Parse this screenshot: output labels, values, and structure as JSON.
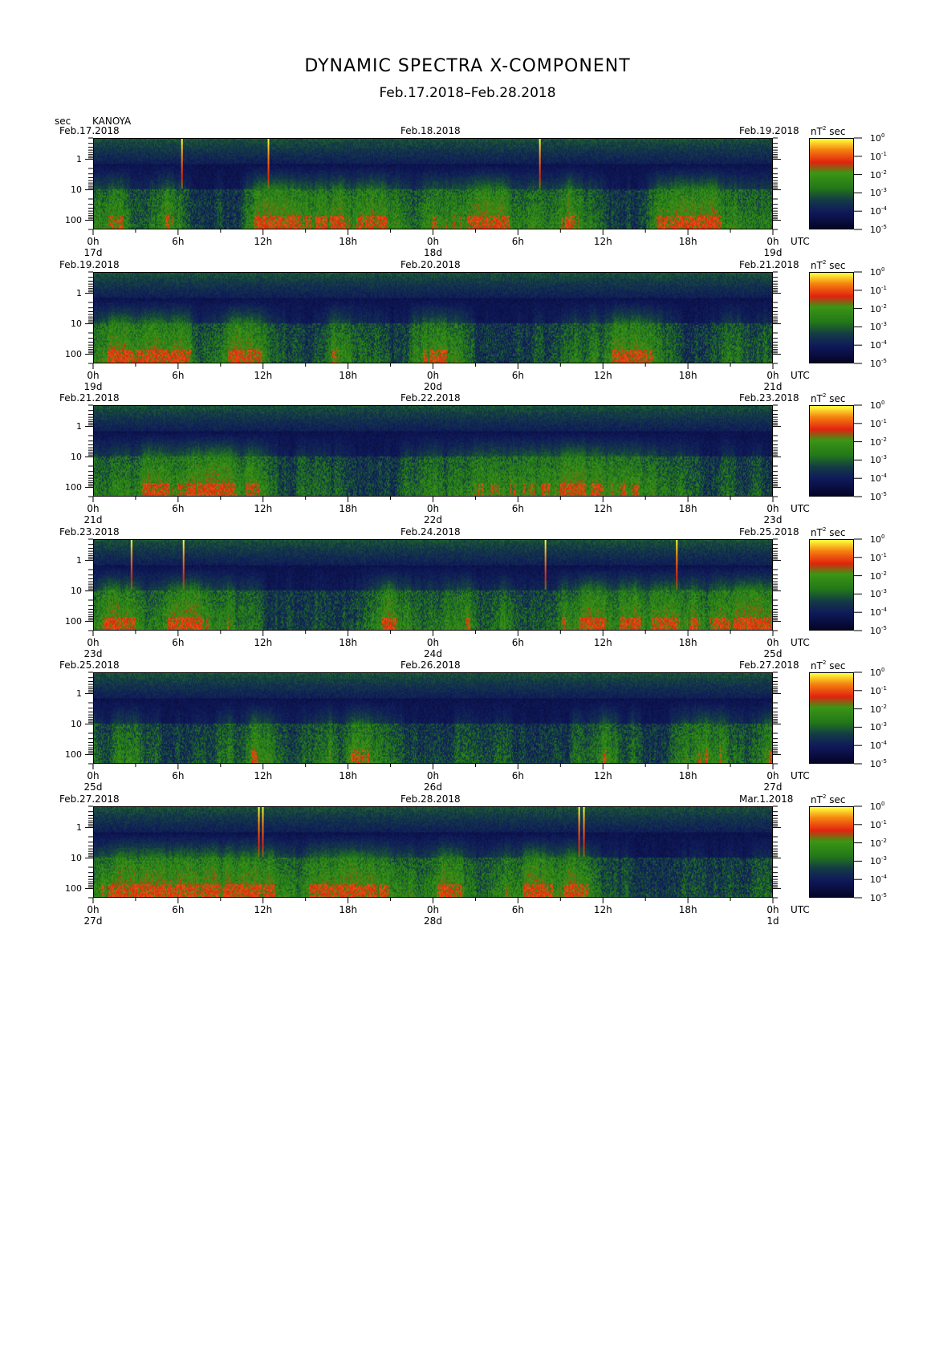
{
  "title": "DYNAMIC SPECTRA X-COMPONENT",
  "subtitle": "Feb.17.2018–Feb.28.2018",
  "y_unit": "sec",
  "station": "KANOYA",
  "colorbar_unit_pre": "nT",
  "colorbar_unit_sup": "2",
  "colorbar_unit_post": "sec",
  "utc": "UTC",
  "colors": {
    "low": "#0a0a4a",
    "mid_low": "#1a2a6a",
    "green": "#2a8a1a",
    "red": "#e02010",
    "orange": "#f08010",
    "yellow": "#ffff30"
  },
  "chart_data": [
    {
      "type": "heatmap",
      "dates": [
        "Feb.17.2018",
        "Feb.18.2018",
        "Feb.19.2018"
      ],
      "x_ticks": [
        "0h",
        "6h",
        "12h",
        "18h",
        "0h",
        "6h",
        "12h",
        "18h",
        "0h"
      ],
      "day_labels": [
        "17d",
        "18d",
        "19d"
      ],
      "y_ticks": [
        "1",
        "10",
        "100"
      ],
      "colorbar_exponents": [
        "0",
        "-1",
        "-2",
        "-3",
        "-4",
        "-5"
      ],
      "spikes_hours": [
        6.2,
        12.3,
        31.5
      ]
    },
    {
      "type": "heatmap",
      "dates": [
        "Feb.19.2018",
        "Feb.20.2018",
        "Feb.21.2018"
      ],
      "x_ticks": [
        "0h",
        "6h",
        "12h",
        "18h",
        "0h",
        "6h",
        "12h",
        "18h",
        "0h"
      ],
      "day_labels": [
        "19d",
        "20d",
        "21d"
      ],
      "y_ticks": [
        "1",
        "10",
        "100"
      ],
      "colorbar_exponents": [
        "0",
        "-1",
        "-2",
        "-3",
        "-4",
        "-5"
      ],
      "spikes_hours": []
    },
    {
      "type": "heatmap",
      "dates": [
        "Feb.21.2018",
        "Feb.22.2018",
        "Feb.23.2018"
      ],
      "x_ticks": [
        "0h",
        "6h",
        "12h",
        "18h",
        "0h",
        "6h",
        "12h",
        "18h",
        "0h"
      ],
      "day_labels": [
        "21d",
        "22d",
        "23d"
      ],
      "y_ticks": [
        "1",
        "10",
        "100"
      ],
      "colorbar_exponents": [
        "0",
        "-1",
        "-2",
        "-3",
        "-4",
        "-5"
      ],
      "spikes_hours": []
    },
    {
      "type": "heatmap",
      "dates": [
        "Feb.23.2018",
        "Feb.24.2018",
        "Feb.25.2018"
      ],
      "x_ticks": [
        "0h",
        "6h",
        "12h",
        "18h",
        "0h",
        "6h",
        "12h",
        "18h",
        "0h"
      ],
      "day_labels": [
        "23d",
        "24d",
        "25d"
      ],
      "y_ticks": [
        "1",
        "10",
        "100"
      ],
      "colorbar_exponents": [
        "0",
        "-1",
        "-2",
        "-3",
        "-4",
        "-5"
      ],
      "spikes_hours": [
        2.6,
        6.3,
        31.9,
        41.2
      ]
    },
    {
      "type": "heatmap",
      "dates": [
        "Feb.25.2018",
        "Feb.26.2018",
        "Feb.27.2018"
      ],
      "x_ticks": [
        "0h",
        "6h",
        "12h",
        "18h",
        "0h",
        "6h",
        "12h",
        "18h",
        "0h"
      ],
      "day_labels": [
        "25d",
        "26d",
        "27d"
      ],
      "y_ticks": [
        "1",
        "10",
        "100"
      ],
      "colorbar_exponents": [
        "0",
        "-1",
        "-2",
        "-3",
        "-4",
        "-5"
      ],
      "spikes_hours": []
    },
    {
      "type": "heatmap",
      "dates": [
        "Feb.27.2018",
        "Feb.28.2018",
        "Mar.1.2018"
      ],
      "x_ticks": [
        "0h",
        "6h",
        "12h",
        "18h",
        "0h",
        "6h",
        "12h",
        "18h",
        "0h"
      ],
      "day_labels": [
        "27d",
        "28d",
        "1d"
      ],
      "y_ticks": [
        "1",
        "10",
        "100"
      ],
      "colorbar_exponents": [
        "0",
        "-1",
        "-2",
        "-3",
        "-4",
        "-5"
      ],
      "spikes_hours": [
        11.6,
        11.9,
        34.3,
        34.6
      ]
    }
  ]
}
